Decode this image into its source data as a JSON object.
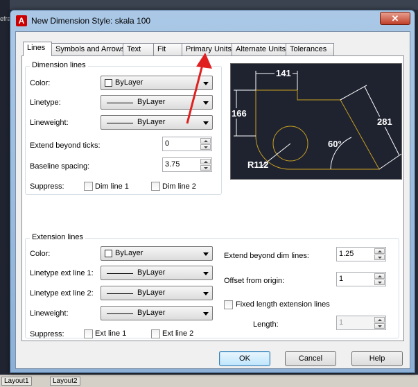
{
  "background": {
    "left_fragment": "efra",
    "layout_tabs": [
      "Layout1",
      "Layout2"
    ]
  },
  "dialog": {
    "title": "New Dimension Style: skala 100",
    "close_glyph": "✕",
    "app_icon_glyph": "A",
    "tabs": [
      "Lines",
      "Symbols and Arrows",
      "Text",
      "Fit",
      "Primary Units",
      "Alternate Units",
      "Tolerances"
    ],
    "active_tab": "Lines"
  },
  "dimension_lines": {
    "title": "Dimension lines",
    "color_label": "Color:",
    "color_value": "ByLayer",
    "linetype_label": "Linetype:",
    "linetype_value": "ByLayer",
    "lineweight_label": "Lineweight:",
    "lineweight_value": "ByLayer",
    "extend_label": "Extend beyond ticks:",
    "extend_value": "0",
    "baseline_label": "Baseline spacing:",
    "baseline_value": "3.75",
    "suppress_label": "Suppress:",
    "dim_line_1": "Dim line 1",
    "dim_line_2": "Dim line 2"
  },
  "extension_lines": {
    "title": "Extension lines",
    "color_label": "Color:",
    "color_value": "ByLayer",
    "linetype1_label": "Linetype ext line 1:",
    "linetype1_value": "ByLayer",
    "linetype2_label": "Linetype ext line 2:",
    "linetype2_value": "ByLayer",
    "lineweight_label": "Lineweight:",
    "lineweight_value": "ByLayer",
    "suppress_label": "Suppress:",
    "ext_line_1": "Ext line 1",
    "ext_line_2": "Ext line 2",
    "extend_dim_label": "Extend beyond dim lines:",
    "extend_dim_value": "1.25",
    "offset_label": "Offset from origin:",
    "offset_value": "1",
    "fixed_length_label": "Fixed length extension lines",
    "length_label": "Length:",
    "length_value": "1"
  },
  "preview": {
    "dim_top": "141",
    "dim_left": "166",
    "dim_right": "281",
    "angle": "60°",
    "radius": "R112"
  },
  "buttons": {
    "ok": "OK",
    "cancel": "Cancel",
    "help": "Help"
  },
  "colors": {
    "annotation_arrow": "#e02020",
    "preview_bg": "#1f2330",
    "geometry": "#c8a020",
    "dimension": "#ffffff"
  }
}
